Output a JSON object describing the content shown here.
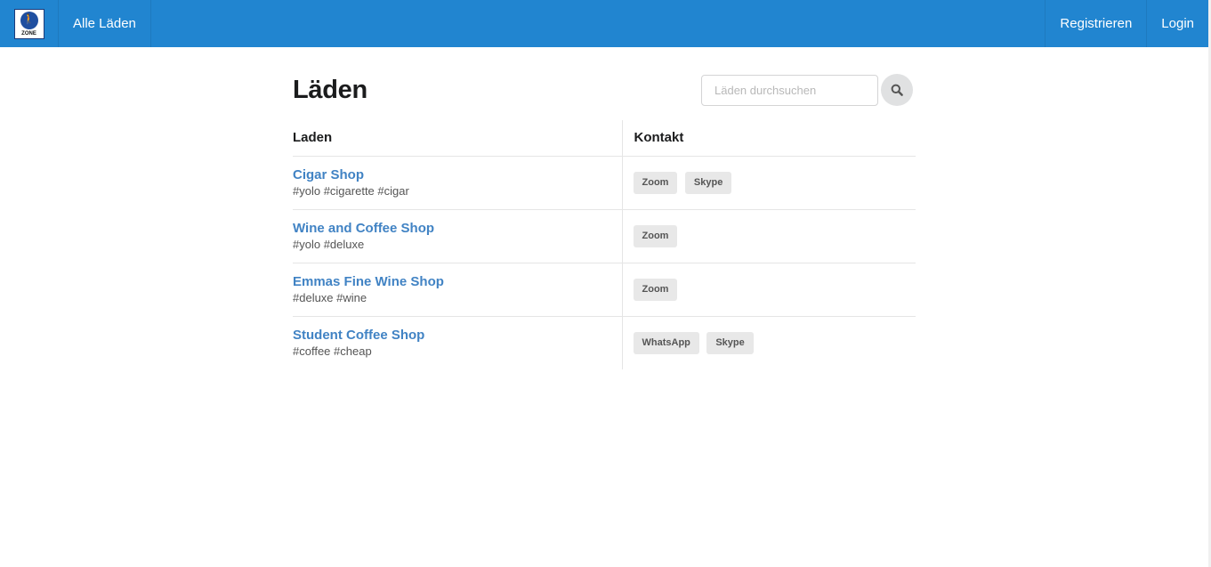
{
  "nav": {
    "logo_text": "ZONE",
    "all_shops": "Alle Läden",
    "register": "Registrieren",
    "login": "Login"
  },
  "page": {
    "title": "Läden",
    "search_placeholder": "Läden durchsuchen"
  },
  "table": {
    "headers": [
      "Laden",
      "Kontakt"
    ],
    "rows": [
      {
        "name": "Cigar Shop",
        "tags": "#yolo #cigarette #cigar",
        "contacts": [
          "Zoom",
          "Skype"
        ]
      },
      {
        "name": "Wine and Coffee Shop",
        "tags": "#yolo #deluxe",
        "contacts": [
          "Zoom"
        ]
      },
      {
        "name": "Emmas Fine Wine Shop",
        "tags": "#deluxe #wine",
        "contacts": [
          "Zoom"
        ]
      },
      {
        "name": "Student Coffee Shop",
        "tags": "#coffee #cheap",
        "contacts": [
          "WhatsApp",
          "Skype"
        ]
      }
    ]
  },
  "colors": {
    "navbar": "#2185d0",
    "link": "#4183c4"
  }
}
